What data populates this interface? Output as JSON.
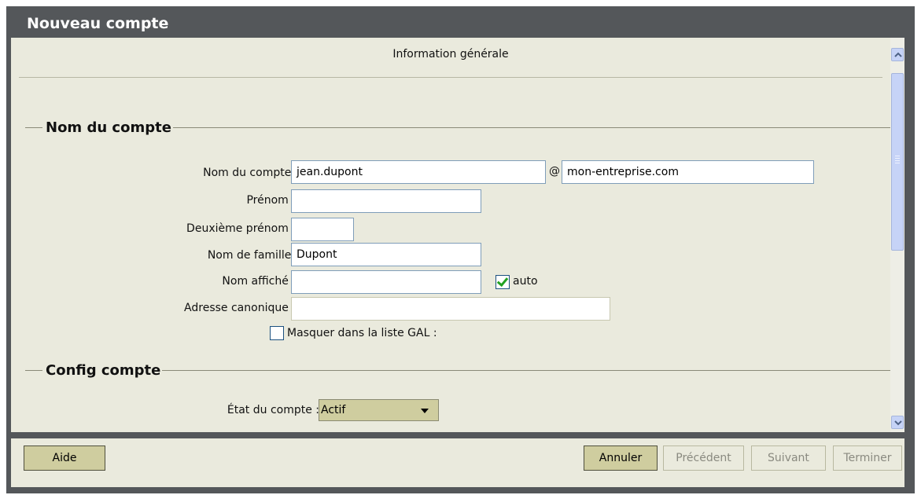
{
  "window": {
    "title": "Nouveau compte"
  },
  "header": {
    "title": "Information générale"
  },
  "section_account": {
    "title": "Nom du compte",
    "account_name": {
      "label": "Nom du compte :",
      "required": "*",
      "value": "jean.dupont",
      "at": "@",
      "domain": "mon-entreprise.com"
    },
    "first_name": {
      "label": "Prénom :",
      "value": ""
    },
    "middle_name": {
      "label": "Deuxième prénom :",
      "value": ""
    },
    "last_name": {
      "label": "Nom de famille :",
      "required": "*",
      "value": "Dupont"
    },
    "display_name": {
      "label": "Nom affiché :",
      "value": "",
      "auto_label": "auto",
      "auto_checked": true
    },
    "canonical_address": {
      "label": "Adresse canonique :",
      "value": ""
    },
    "hide_gal": {
      "label": "Masquer dans la liste GAL :",
      "checked": false
    }
  },
  "section_config": {
    "title": "Config compte",
    "account_state": {
      "label": "État du compte :",
      "selected": "Actif"
    }
  },
  "buttons": {
    "help": "Aide",
    "cancel": "Annuler",
    "previous": "Précédent",
    "next": "Suivant",
    "finish": "Terminer"
  },
  "colors": {
    "title_bar": "#54575a",
    "panel": "#eaeadd",
    "button_active": "#cfcd9f",
    "required": "#c00000"
  }
}
